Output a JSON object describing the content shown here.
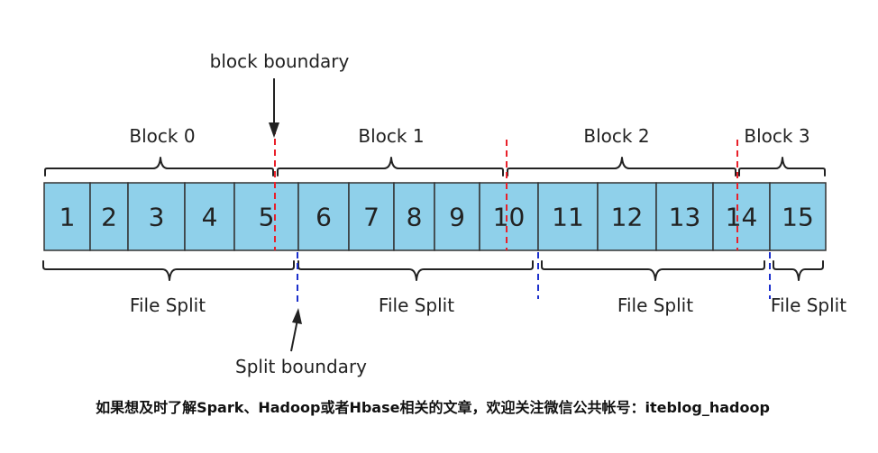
{
  "diagram": {
    "cells": [
      "1",
      "2",
      "3",
      "4",
      "5",
      "6",
      "7",
      "8",
      "9",
      "10",
      "11",
      "12",
      "13",
      "14",
      "15"
    ],
    "block_labels": [
      "Block 0",
      "Block 1",
      "Block 2",
      "Block 3"
    ],
    "split_labels": [
      "File Split",
      "File Split",
      "File Split",
      "File Split"
    ],
    "block_boundary_label": "block boundary",
    "split_boundary_label": "Split boundary",
    "colors": {
      "cell_fill": "#8fd0ea",
      "cell_border": "#333333",
      "block_boundary": "#e8202a",
      "split_boundary": "#1b2fcc"
    }
  },
  "footer": {
    "caption": "如果想及时了解Spark、Hadoop或者Hbase相关的文章，欢迎关注微信公共帐号：iteblog_hadoop"
  }
}
